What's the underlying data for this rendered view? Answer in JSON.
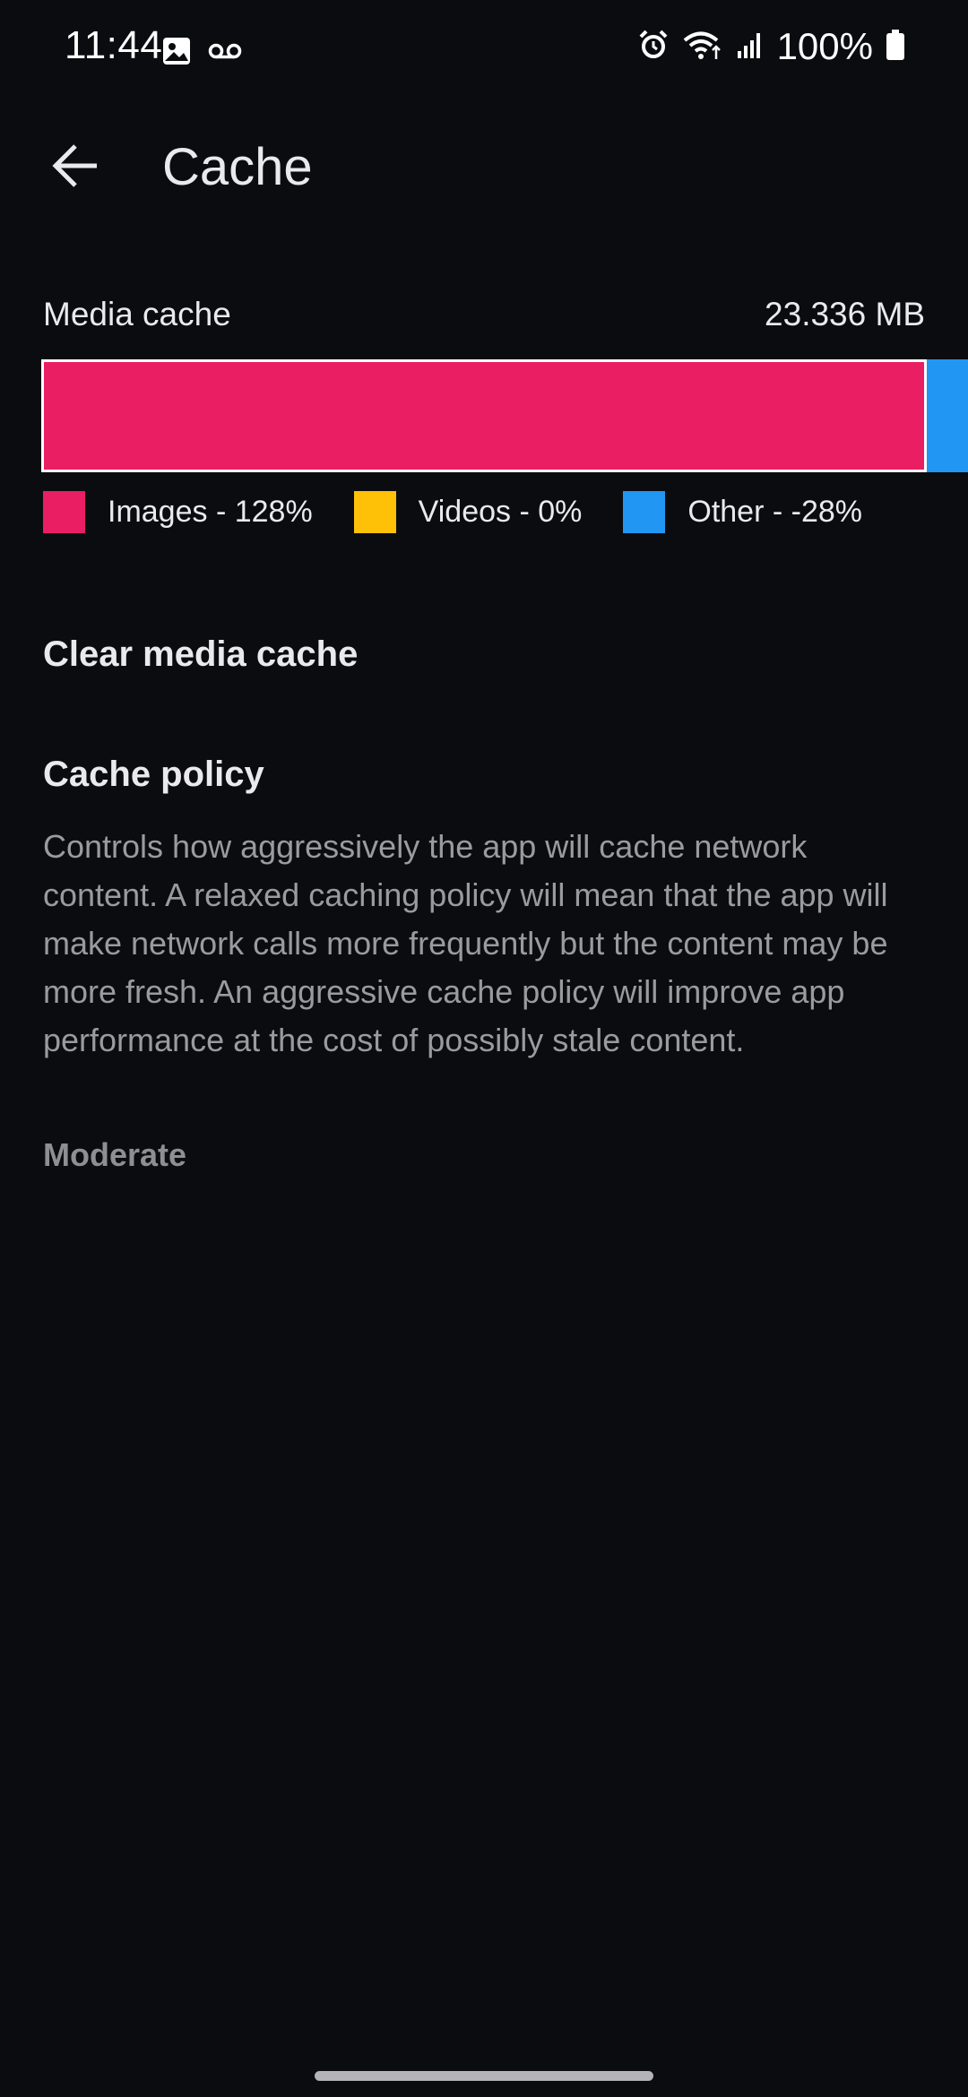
{
  "status_bar": {
    "time": "11:44",
    "battery_percent": "100%",
    "left_icons": [
      "gallery-icon",
      "voicemail-icon"
    ],
    "right_icons": [
      "alarm-icon",
      "wifi-icon",
      "signal-icon",
      "battery-icon"
    ]
  },
  "appbar": {
    "title": "Cache",
    "back_icon": "arrow-back-icon"
  },
  "media_cache": {
    "label": "Media cache",
    "size": "23.336 MB",
    "bar": {
      "images_fraction": 1.28,
      "videos_fraction": 0.0,
      "other_fraction": -0.28
    },
    "legend": [
      {
        "label": "Images - 128%",
        "color": "#e91e63"
      },
      {
        "label": "Videos - 0%",
        "color": "#ffc107"
      },
      {
        "label": "Other - -28%",
        "color": "#2196f3"
      }
    ]
  },
  "clear_media_cache": {
    "label": "Clear media cache"
  },
  "cache_policy": {
    "title": "Cache policy",
    "description": "Controls how aggressively the app will cache network content. A relaxed caching policy will mean that the app will make network calls more frequently but the content may be more fresh. An aggressive cache policy will improve app performance at the cost of possibly stale content.",
    "value": "Moderate"
  },
  "colors": {
    "background": "#0b0c0f",
    "images": "#e91e63",
    "videos": "#ffc107",
    "other": "#2196f3"
  }
}
